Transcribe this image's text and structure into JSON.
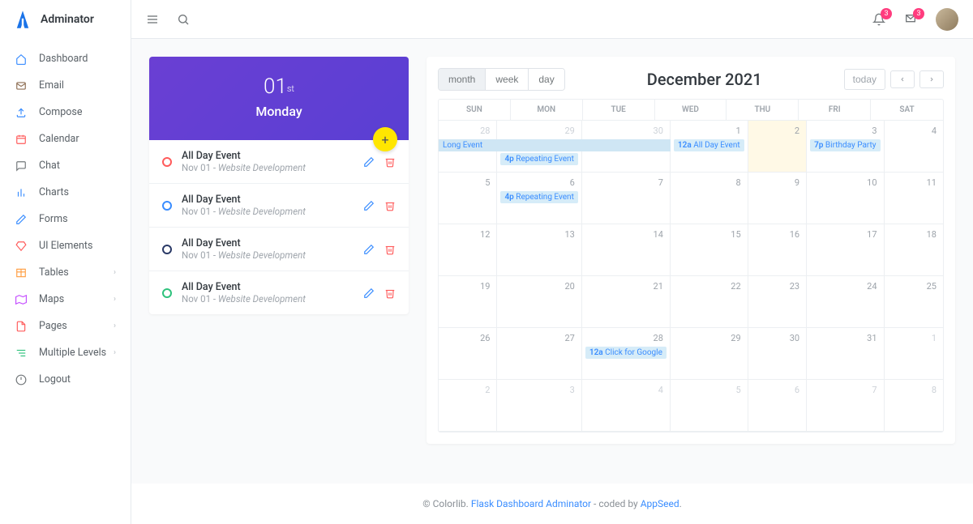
{
  "app_name": "Adminator",
  "topbar": {
    "notif_badge": "3",
    "msg_badge": "3"
  },
  "sidebar": {
    "items": [
      {
        "label": "Dashboard",
        "icon": "home",
        "color": "#3a8dff"
      },
      {
        "label": "Email",
        "icon": "mail",
        "color": "#8e6e53"
      },
      {
        "label": "Compose",
        "icon": "upload",
        "color": "#3a8dff"
      },
      {
        "label": "Calendar",
        "icon": "calendar",
        "color": "#ff5b5b"
      },
      {
        "label": "Chat",
        "icon": "chat",
        "color": "#72777a"
      },
      {
        "label": "Charts",
        "icon": "chart",
        "color": "#3a8dff"
      },
      {
        "label": "Forms",
        "icon": "pencil",
        "color": "#3a8dff"
      },
      {
        "label": "UI Elements",
        "icon": "diamond",
        "color": "#ff5b5b"
      },
      {
        "label": "Tables",
        "icon": "tables",
        "color": "#ff9f43",
        "arrow": true
      },
      {
        "label": "Maps",
        "icon": "map",
        "color": "#c44dff",
        "arrow": true
      },
      {
        "label": "Pages",
        "icon": "pages",
        "color": "#ff5b5b",
        "arrow": true
      },
      {
        "label": "Multiple Levels",
        "icon": "levels",
        "color": "#2fc27d",
        "arrow": true
      },
      {
        "label": "Logout",
        "icon": "logout",
        "color": "#72777a"
      }
    ]
  },
  "date_banner": {
    "day": "01",
    "suffix": "st",
    "weekday": "Monday"
  },
  "events": [
    {
      "title": "All Day Event",
      "date": "Nov 01",
      "project": "Website Development",
      "dot": "red"
    },
    {
      "title": "All Day Event",
      "date": "Nov 01",
      "project": "Website Development",
      "dot": "blue"
    },
    {
      "title": "All Day Event",
      "date": "Nov 01",
      "project": "Website Development",
      "dot": "navy"
    },
    {
      "title": "All Day Event",
      "date": "Nov 01",
      "project": "Website Development",
      "dot": "green"
    }
  ],
  "calendar": {
    "title": "December 2021",
    "views": {
      "month": "month",
      "week": "week",
      "day": "day"
    },
    "today_label": "today",
    "day_headers": [
      "SUN",
      "MON",
      "TUE",
      "WED",
      "THU",
      "FRI",
      "SAT"
    ],
    "weeks": [
      [
        {
          "n": "28",
          "other": true,
          "long": {
            "text": "Long Event",
            "role": "start"
          }
        },
        {
          "n": "29",
          "other": true,
          "long": {
            "text": "",
            "role": "mid"
          },
          "items": [
            {
              "t": "4p",
              "txt": "Repeating Event"
            }
          ]
        },
        {
          "n": "30",
          "other": true,
          "long": {
            "text": "",
            "role": "end"
          }
        },
        {
          "n": "1",
          "items": [
            {
              "t": "12a",
              "txt": "All Day Event"
            }
          ]
        },
        {
          "n": "2",
          "today": true
        },
        {
          "n": "3",
          "items": [
            {
              "t": "7p",
              "txt": "Birthday Party"
            }
          ]
        },
        {
          "n": "4"
        }
      ],
      [
        {
          "n": "5"
        },
        {
          "n": "6",
          "items": [
            {
              "t": "4p",
              "txt": "Repeating Event"
            }
          ]
        },
        {
          "n": "7"
        },
        {
          "n": "8"
        },
        {
          "n": "9"
        },
        {
          "n": "10"
        },
        {
          "n": "11"
        }
      ],
      [
        {
          "n": "12"
        },
        {
          "n": "13"
        },
        {
          "n": "14"
        },
        {
          "n": "15"
        },
        {
          "n": "16"
        },
        {
          "n": "17"
        },
        {
          "n": "18"
        }
      ],
      [
        {
          "n": "19"
        },
        {
          "n": "20"
        },
        {
          "n": "21"
        },
        {
          "n": "22"
        },
        {
          "n": "23"
        },
        {
          "n": "24"
        },
        {
          "n": "25"
        }
      ],
      [
        {
          "n": "26"
        },
        {
          "n": "27"
        },
        {
          "n": "28",
          "items": [
            {
              "t": "12a",
              "txt": "Click for Google"
            }
          ]
        },
        {
          "n": "29"
        },
        {
          "n": "30"
        },
        {
          "n": "31"
        },
        {
          "n": "1",
          "other": true
        }
      ],
      [
        {
          "n": "2",
          "other": true
        },
        {
          "n": "3",
          "other": true
        },
        {
          "n": "4",
          "other": true
        },
        {
          "n": "5",
          "other": true
        },
        {
          "n": "6",
          "other": true
        },
        {
          "n": "7",
          "other": true
        },
        {
          "n": "8",
          "other": true
        }
      ]
    ]
  },
  "footer": {
    "pre": "© Colorlib. ",
    "link1": "Flask Dashboard Adminator",
    "mid": " - coded by ",
    "link2": "AppSeed",
    "suffix": "."
  }
}
